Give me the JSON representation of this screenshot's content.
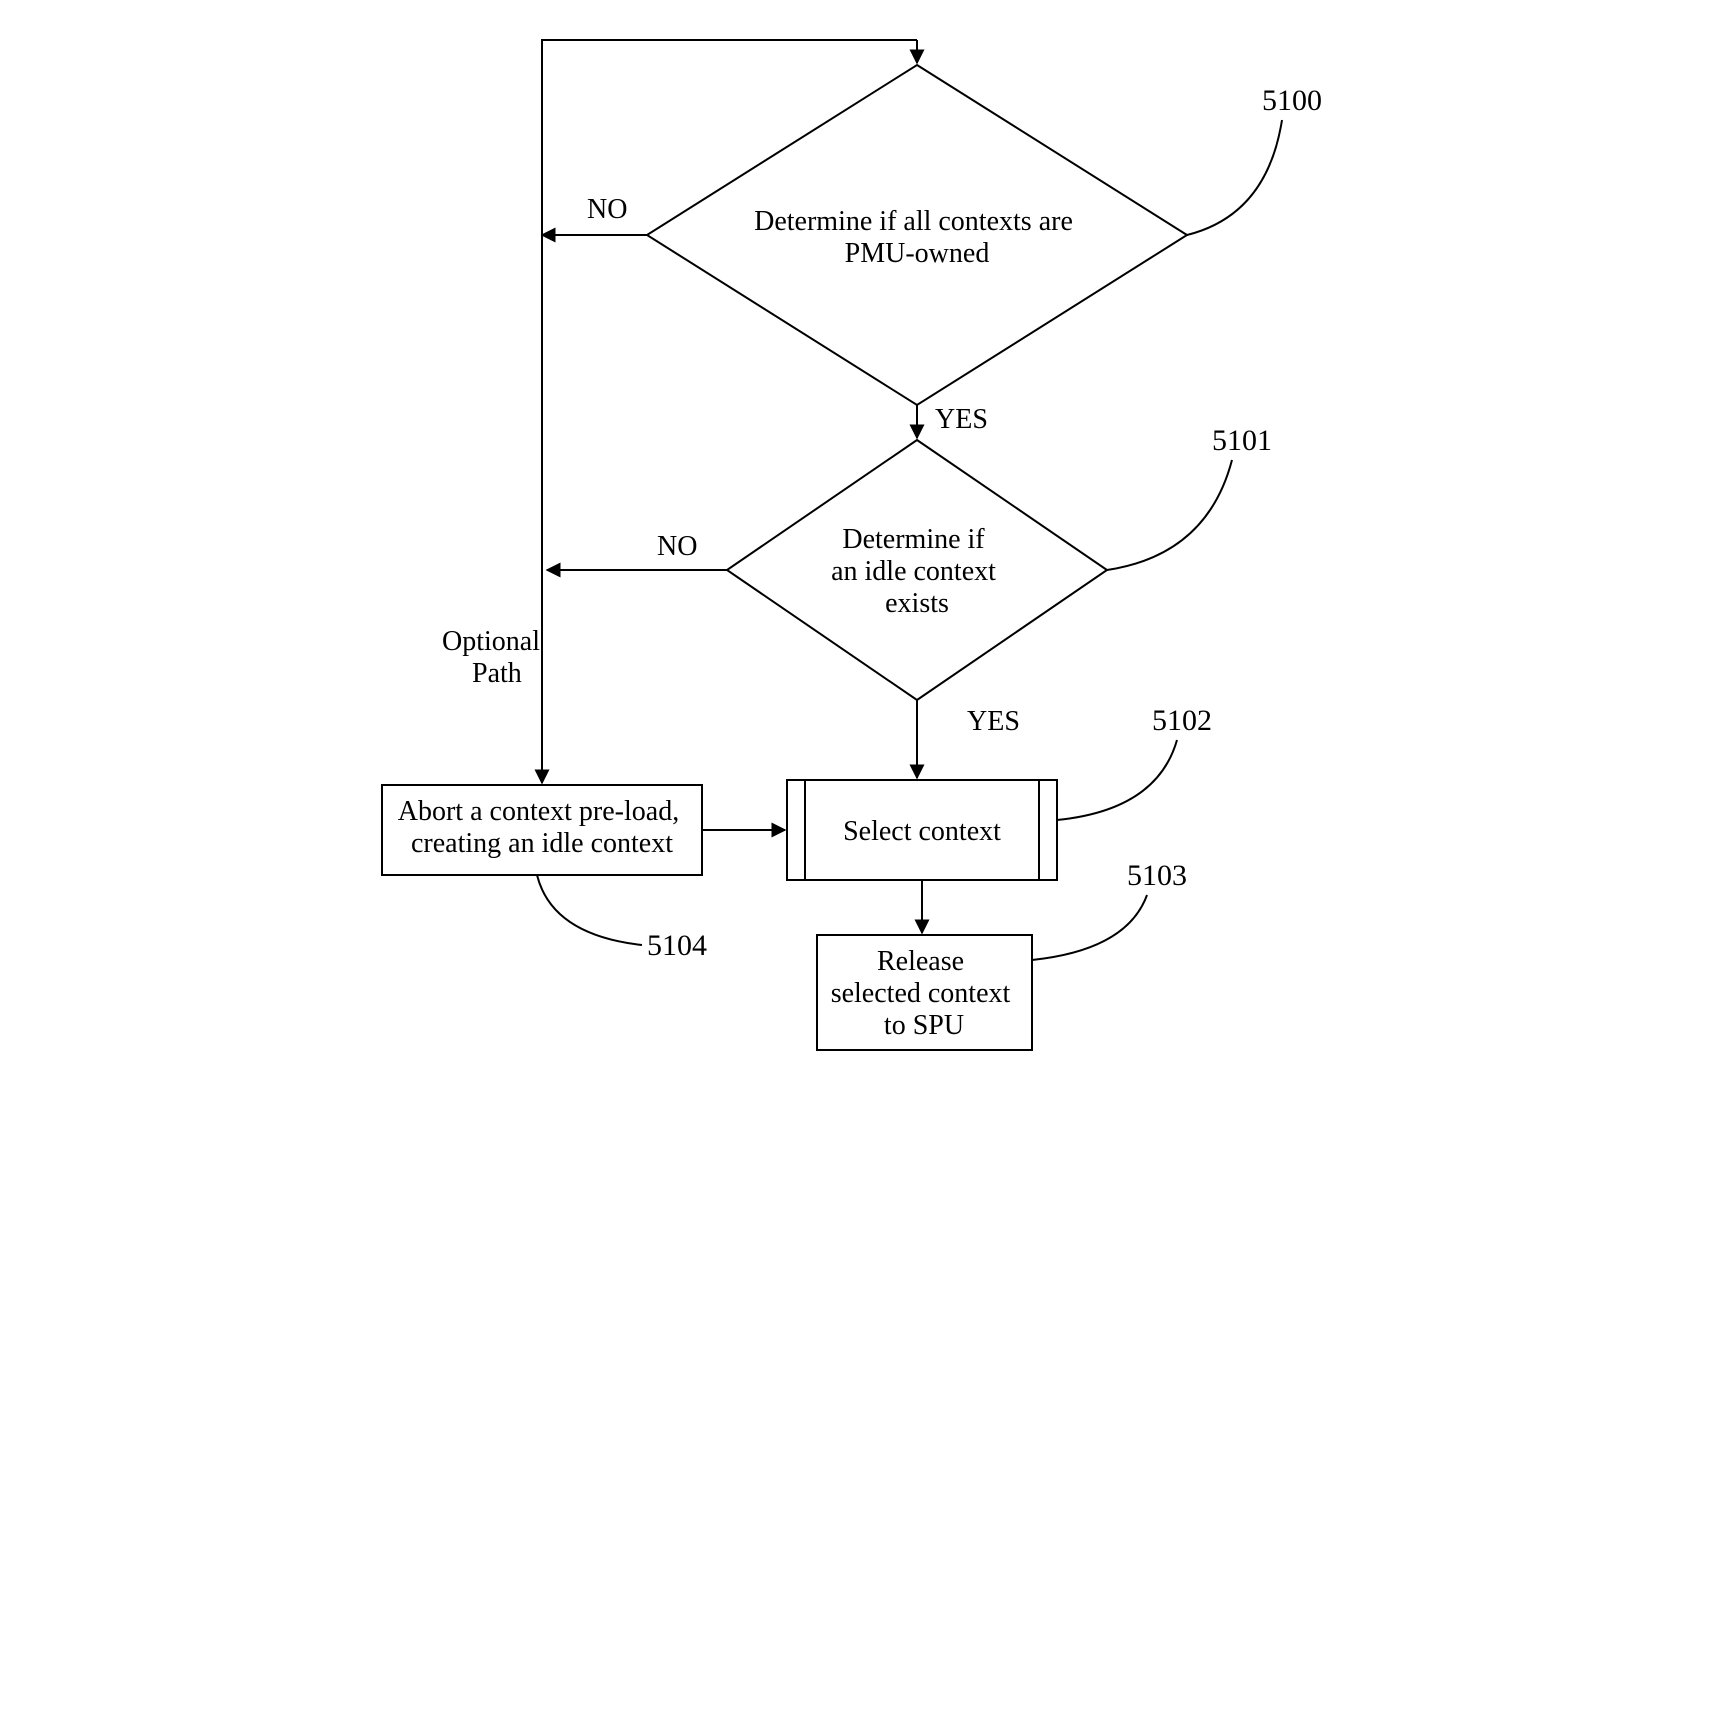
{
  "nodes": {
    "d5100": {
      "line1": "Determine if all contexts are",
      "line2": "PMU-owned",
      "ref": "5100"
    },
    "d5101": {
      "line1": "Determine if",
      "line2": "an idle context",
      "line3": "exists",
      "ref": "5101"
    },
    "p5102": {
      "line1": "Select context",
      "ref": "5102"
    },
    "p5103": {
      "line1": "Release",
      "line2": "selected context",
      "line3": "to SPU",
      "ref": "5103"
    },
    "p5104": {
      "line1": "Abort a context pre-load,",
      "line2": "creating an idle context",
      "ref": "5104"
    }
  },
  "labels": {
    "no": "NO",
    "yes": "YES",
    "optional1": "Optional",
    "optional2": "Path"
  }
}
